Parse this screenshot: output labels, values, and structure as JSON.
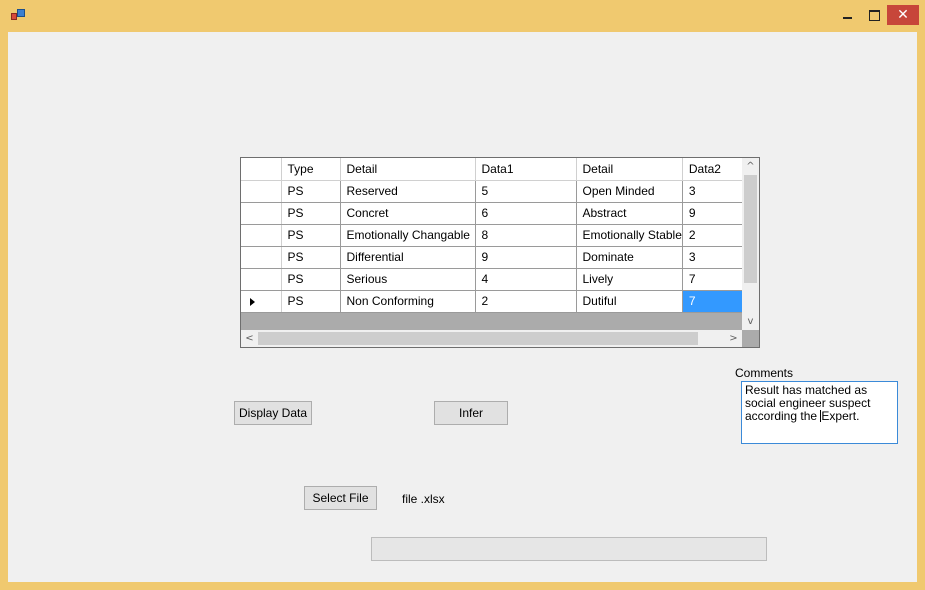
{
  "window": {
    "close_glyph": "✕"
  },
  "grid": {
    "columns": [
      "Type",
      "Detail",
      "Data1",
      "Detail",
      "Data2"
    ],
    "rows": [
      [
        "PS",
        "Reserved",
        "5",
        "Open Minded",
        "3"
      ],
      [
        "PS",
        "Concret",
        "6",
        "Abstract",
        "9"
      ],
      [
        "PS",
        "Emotionally Changable",
        "8",
        "Emotionally Stable",
        "2"
      ],
      [
        "PS",
        "Differential",
        "9",
        "Dominate",
        "3"
      ],
      [
        "PS",
        "Serious",
        "4",
        "Lively",
        "7"
      ],
      [
        "PS",
        "Non Conforming",
        "2",
        "Dutiful",
        "7"
      ]
    ],
    "scroll_up_glyph": "^",
    "scroll_down_glyph": "v",
    "scroll_left_glyph": "<",
    "scroll_right_glyph": ">"
  },
  "buttons": {
    "display_data": "Display Data",
    "infer": "Infer",
    "select_file": "Select File"
  },
  "labels": {
    "comments": "Comments",
    "file_name": "file .xlsx"
  },
  "comments_text": {
    "before_caret": "Result has matched as social engineer suspect according the ",
    "after_caret": "Expert."
  },
  "colors": {
    "title_bar": "#f0c96f",
    "close_button": "#c7463a",
    "selection": "#3399ff"
  }
}
